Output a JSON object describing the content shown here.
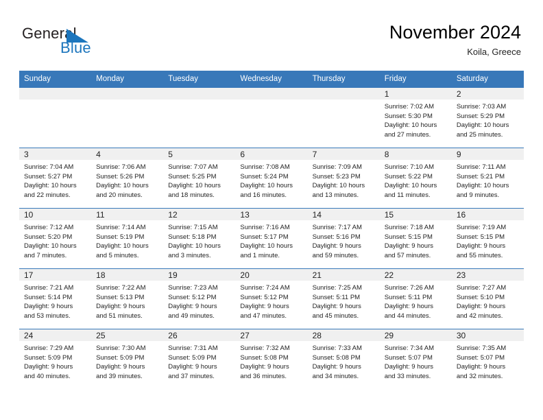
{
  "brand": {
    "name_part1": "General",
    "name_part2": "Blue",
    "mark": "triangle-logo-icon",
    "accent_color": "#1d76bd"
  },
  "header": {
    "title": "November 2024",
    "subtitle": "Koila, Greece"
  },
  "theme": {
    "header_blue": "#3878b9",
    "daynum_gray": "#f0f0f0",
    "text": "#222222"
  },
  "calendar": {
    "weekday_headers": [
      "Sunday",
      "Monday",
      "Tuesday",
      "Wednesday",
      "Thursday",
      "Friday",
      "Saturday"
    ],
    "weeks": [
      [
        {
          "day": "",
          "empty": true,
          "sunrise": "",
          "sunset": "",
          "daylight_line1": "",
          "daylight_line2": ""
        },
        {
          "day": "",
          "empty": true,
          "sunrise": "",
          "sunset": "",
          "daylight_line1": "",
          "daylight_line2": ""
        },
        {
          "day": "",
          "empty": true,
          "sunrise": "",
          "sunset": "",
          "daylight_line1": "",
          "daylight_line2": ""
        },
        {
          "day": "",
          "empty": true,
          "sunrise": "",
          "sunset": "",
          "daylight_line1": "",
          "daylight_line2": ""
        },
        {
          "day": "",
          "empty": true,
          "sunrise": "",
          "sunset": "",
          "daylight_line1": "",
          "daylight_line2": ""
        },
        {
          "day": "1",
          "sunrise": "Sunrise: 7:02 AM",
          "sunset": "Sunset: 5:30 PM",
          "daylight_line1": "Daylight: 10 hours",
          "daylight_line2": "and 27 minutes."
        },
        {
          "day": "2",
          "sunrise": "Sunrise: 7:03 AM",
          "sunset": "Sunset: 5:29 PM",
          "daylight_line1": "Daylight: 10 hours",
          "daylight_line2": "and 25 minutes."
        }
      ],
      [
        {
          "day": "3",
          "sunrise": "Sunrise: 7:04 AM",
          "sunset": "Sunset: 5:27 PM",
          "daylight_line1": "Daylight: 10 hours",
          "daylight_line2": "and 22 minutes."
        },
        {
          "day": "4",
          "sunrise": "Sunrise: 7:06 AM",
          "sunset": "Sunset: 5:26 PM",
          "daylight_line1": "Daylight: 10 hours",
          "daylight_line2": "and 20 minutes."
        },
        {
          "day": "5",
          "sunrise": "Sunrise: 7:07 AM",
          "sunset": "Sunset: 5:25 PM",
          "daylight_line1": "Daylight: 10 hours",
          "daylight_line2": "and 18 minutes."
        },
        {
          "day": "6",
          "sunrise": "Sunrise: 7:08 AM",
          "sunset": "Sunset: 5:24 PM",
          "daylight_line1": "Daylight: 10 hours",
          "daylight_line2": "and 16 minutes."
        },
        {
          "day": "7",
          "sunrise": "Sunrise: 7:09 AM",
          "sunset": "Sunset: 5:23 PM",
          "daylight_line1": "Daylight: 10 hours",
          "daylight_line2": "and 13 minutes."
        },
        {
          "day": "8",
          "sunrise": "Sunrise: 7:10 AM",
          "sunset": "Sunset: 5:22 PM",
          "daylight_line1": "Daylight: 10 hours",
          "daylight_line2": "and 11 minutes."
        },
        {
          "day": "9",
          "sunrise": "Sunrise: 7:11 AM",
          "sunset": "Sunset: 5:21 PM",
          "daylight_line1": "Daylight: 10 hours",
          "daylight_line2": "and 9 minutes."
        }
      ],
      [
        {
          "day": "10",
          "sunrise": "Sunrise: 7:12 AM",
          "sunset": "Sunset: 5:20 PM",
          "daylight_line1": "Daylight: 10 hours",
          "daylight_line2": "and 7 minutes."
        },
        {
          "day": "11",
          "sunrise": "Sunrise: 7:14 AM",
          "sunset": "Sunset: 5:19 PM",
          "daylight_line1": "Daylight: 10 hours",
          "daylight_line2": "and 5 minutes."
        },
        {
          "day": "12",
          "sunrise": "Sunrise: 7:15 AM",
          "sunset": "Sunset: 5:18 PM",
          "daylight_line1": "Daylight: 10 hours",
          "daylight_line2": "and 3 minutes."
        },
        {
          "day": "13",
          "sunrise": "Sunrise: 7:16 AM",
          "sunset": "Sunset: 5:17 PM",
          "daylight_line1": "Daylight: 10 hours",
          "daylight_line2": "and 1 minute."
        },
        {
          "day": "14",
          "sunrise": "Sunrise: 7:17 AM",
          "sunset": "Sunset: 5:16 PM",
          "daylight_line1": "Daylight: 9 hours",
          "daylight_line2": "and 59 minutes."
        },
        {
          "day": "15",
          "sunrise": "Sunrise: 7:18 AM",
          "sunset": "Sunset: 5:15 PM",
          "daylight_line1": "Daylight: 9 hours",
          "daylight_line2": "and 57 minutes."
        },
        {
          "day": "16",
          "sunrise": "Sunrise: 7:19 AM",
          "sunset": "Sunset: 5:15 PM",
          "daylight_line1": "Daylight: 9 hours",
          "daylight_line2": "and 55 minutes."
        }
      ],
      [
        {
          "day": "17",
          "sunrise": "Sunrise: 7:21 AM",
          "sunset": "Sunset: 5:14 PM",
          "daylight_line1": "Daylight: 9 hours",
          "daylight_line2": "and 53 minutes."
        },
        {
          "day": "18",
          "sunrise": "Sunrise: 7:22 AM",
          "sunset": "Sunset: 5:13 PM",
          "daylight_line1": "Daylight: 9 hours",
          "daylight_line2": "and 51 minutes."
        },
        {
          "day": "19",
          "sunrise": "Sunrise: 7:23 AM",
          "sunset": "Sunset: 5:12 PM",
          "daylight_line1": "Daylight: 9 hours",
          "daylight_line2": "and 49 minutes."
        },
        {
          "day": "20",
          "sunrise": "Sunrise: 7:24 AM",
          "sunset": "Sunset: 5:12 PM",
          "daylight_line1": "Daylight: 9 hours",
          "daylight_line2": "and 47 minutes."
        },
        {
          "day": "21",
          "sunrise": "Sunrise: 7:25 AM",
          "sunset": "Sunset: 5:11 PM",
          "daylight_line1": "Daylight: 9 hours",
          "daylight_line2": "and 45 minutes."
        },
        {
          "day": "22",
          "sunrise": "Sunrise: 7:26 AM",
          "sunset": "Sunset: 5:11 PM",
          "daylight_line1": "Daylight: 9 hours",
          "daylight_line2": "and 44 minutes."
        },
        {
          "day": "23",
          "sunrise": "Sunrise: 7:27 AM",
          "sunset": "Sunset: 5:10 PM",
          "daylight_line1": "Daylight: 9 hours",
          "daylight_line2": "and 42 minutes."
        }
      ],
      [
        {
          "day": "24",
          "sunrise": "Sunrise: 7:29 AM",
          "sunset": "Sunset: 5:09 PM",
          "daylight_line1": "Daylight: 9 hours",
          "daylight_line2": "and 40 minutes."
        },
        {
          "day": "25",
          "sunrise": "Sunrise: 7:30 AM",
          "sunset": "Sunset: 5:09 PM",
          "daylight_line1": "Daylight: 9 hours",
          "daylight_line2": "and 39 minutes."
        },
        {
          "day": "26",
          "sunrise": "Sunrise: 7:31 AM",
          "sunset": "Sunset: 5:09 PM",
          "daylight_line1": "Daylight: 9 hours",
          "daylight_line2": "and 37 minutes."
        },
        {
          "day": "27",
          "sunrise": "Sunrise: 7:32 AM",
          "sunset": "Sunset: 5:08 PM",
          "daylight_line1": "Daylight: 9 hours",
          "daylight_line2": "and 36 minutes."
        },
        {
          "day": "28",
          "sunrise": "Sunrise: 7:33 AM",
          "sunset": "Sunset: 5:08 PM",
          "daylight_line1": "Daylight: 9 hours",
          "daylight_line2": "and 34 minutes."
        },
        {
          "day": "29",
          "sunrise": "Sunrise: 7:34 AM",
          "sunset": "Sunset: 5:07 PM",
          "daylight_line1": "Daylight: 9 hours",
          "daylight_line2": "and 33 minutes."
        },
        {
          "day": "30",
          "sunrise": "Sunrise: 7:35 AM",
          "sunset": "Sunset: 5:07 PM",
          "daylight_line1": "Daylight: 9 hours",
          "daylight_line2": "and 32 minutes."
        }
      ]
    ]
  }
}
